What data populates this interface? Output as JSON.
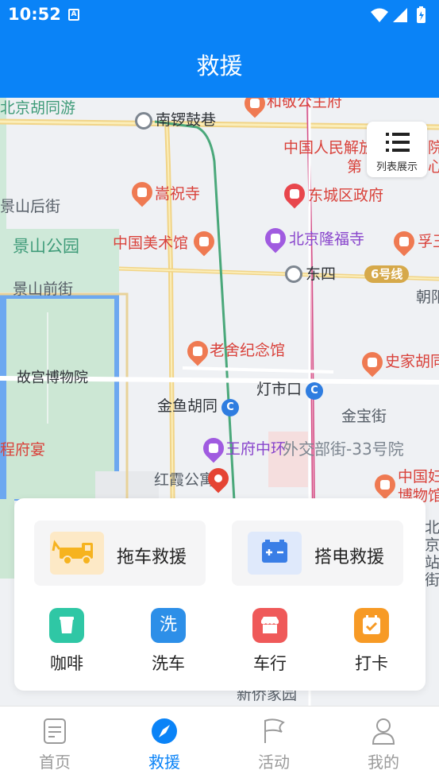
{
  "status_bar": {
    "time": "10:52",
    "notification_icon": "A"
  },
  "header": {
    "title": "救援"
  },
  "map": {
    "labels": {
      "beijing_hutong": "北京胡同游",
      "hejing_gongzhufu": "和敬公主府",
      "nanluoguxiang": "南锣鼓巷",
      "renmin_jiefangjun": "中国人民解放",
      "dier": "第",
      "yuan": "院",
      "xin": "心",
      "songzhusi": "嵩祝寺",
      "dongcheng_gov": "东城区政府",
      "jingshan_houjie": "景山后街",
      "jingshan_park": "景山公园",
      "china_art_museum": "中国美术馆",
      "longfusi": "北京隆福寺",
      "fu_wang": "孚王",
      "jingshan_qianjie": "景山前街",
      "dongsi": "东四",
      "line6": "6号线",
      "chaoyang": "朝阳",
      "laoshe_museum": "老舍纪念馆",
      "shijia_hutong": "史家胡同",
      "palace_museum": "故宫博物院",
      "dengshikou": "灯市口",
      "jinyu_hutong": "金鱼胡同",
      "jinbaojie": "金宝街",
      "cheng_fuyan": "程府宴",
      "wangfu_zhonghuan": "王府中环",
      "waijiaobu_jie": "外交部街-33号院",
      "hongxia_gongyu": "红霞公寓",
      "china_museum": "中国妇",
      "museum_short": "博物馆",
      "beijing_station": "北京站街",
      "xinqiao_jiayuan": "新侨家园"
    }
  },
  "list_button": {
    "label": "列表展示"
  },
  "services": {
    "tow": {
      "label": "拖车救援"
    },
    "jump": {
      "label": "搭电救援"
    },
    "coffee": {
      "label": "咖啡"
    },
    "wash": {
      "label": "洗车",
      "icon_text": "洗"
    },
    "dealer": {
      "label": "车行"
    },
    "checkin": {
      "label": "打卡"
    }
  },
  "tabs": [
    {
      "label": "首页"
    },
    {
      "label": "救援"
    },
    {
      "label": "活动"
    },
    {
      "label": "我的"
    }
  ],
  "colors": {
    "accent": "#0a83f7",
    "inactive": "#9a9a9a"
  }
}
